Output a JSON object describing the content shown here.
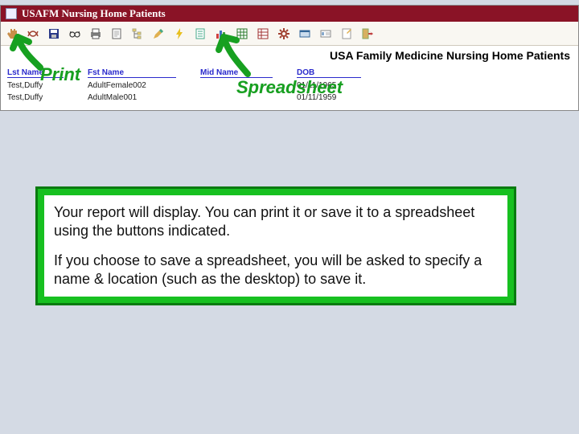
{
  "window": {
    "title": "USAFM Nursing Home Patients"
  },
  "toolbar": {
    "icons": [
      "hand-icon",
      "toggle-icon",
      "save-icon",
      "glasses-icon",
      "print-icon",
      "page-icon",
      "tree-icon",
      "pencil-icon",
      "bolt-icon",
      "sheet-icon",
      "barchart-icon",
      "spreadsheet-icon",
      "xl-icon",
      "gear-icon",
      "view-icon",
      "id-icon",
      "note-icon",
      "exit-icon"
    ]
  },
  "report": {
    "title": "USA Family Medicine Nursing Home Patients",
    "columns": [
      "Lst Name",
      "Fst Name",
      "Mid Name",
      "DOB"
    ],
    "rows": [
      {
        "last": "Test,Duffy",
        "first": "AdultFemale002",
        "mid": "",
        "dob": "01/11/1965"
      },
      {
        "last": "Test,Duffy",
        "first": "AdultMale001",
        "mid": "",
        "dob": "01/11/1959"
      }
    ]
  },
  "callouts": {
    "print": "Print",
    "spreadsheet": "Spreadsheet"
  },
  "instructions": {
    "p1": "Your report will display.  You can print it or save it to a spreadsheet using the buttons indicated.",
    "p2": "If you choose to save a spreadsheet, you will be asked to specify a name & location (such as the desktop) to save it."
  }
}
